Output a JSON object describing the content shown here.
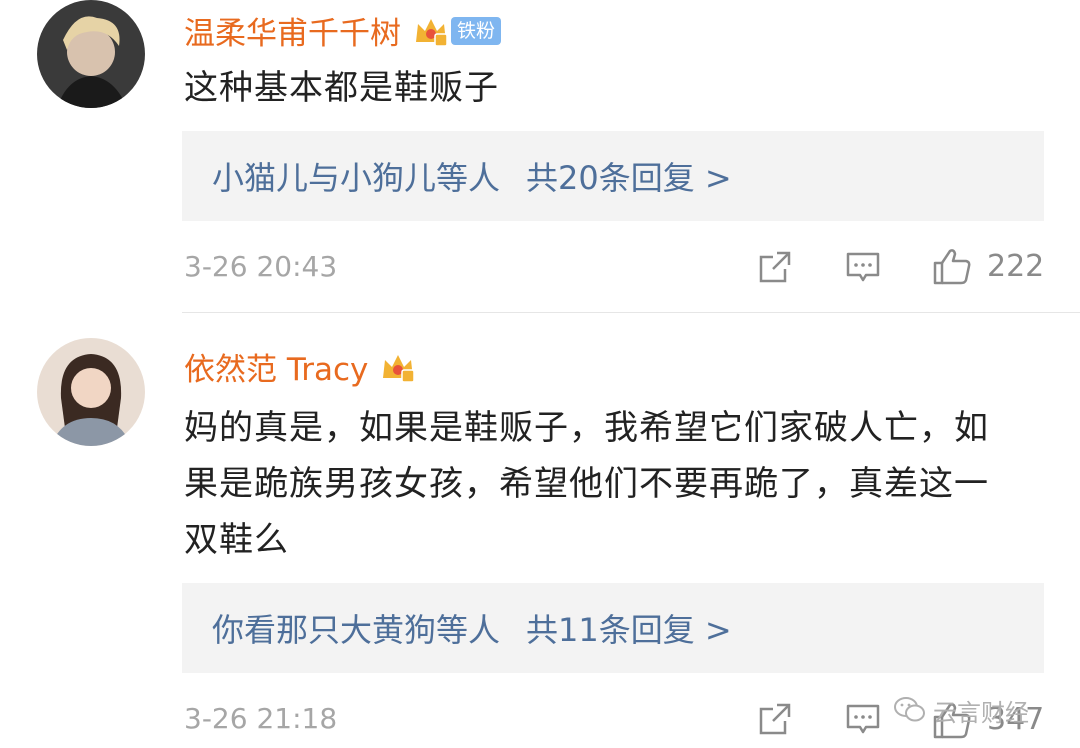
{
  "comments": [
    {
      "username": "温柔华甫千千树",
      "badge": "铁粉",
      "text": "这种基本都是鞋贩子",
      "reply_users": "小猫儿与小狗儿等人",
      "reply_count": "共20条回复 >",
      "time": "3-26 20:43",
      "likes": "222"
    },
    {
      "username": "依然范 Tracy",
      "badge": "",
      "text": "妈的真是，如果是鞋贩子，我希望它们家破人亡，如果是跪族男孩女孩，希望他们不要再跪了，真差这一双鞋么",
      "reply_users": "你看那只大黄狗等人",
      "reply_count": "共11条回复 >",
      "time": "3-26 21:18",
      "likes": "347"
    }
  ],
  "icons": {
    "share": "share-icon",
    "comment": "comment-icon",
    "like": "thumbs-up-icon",
    "crown": "crown-icon",
    "watermark": "wechat-icon"
  },
  "watermark": {
    "text": "云言财经"
  },
  "colors": {
    "username": "#e86a1f",
    "link": "#4e6f9a",
    "reply_bg": "#f3f3f3",
    "meta": "#a6a6a6"
  }
}
